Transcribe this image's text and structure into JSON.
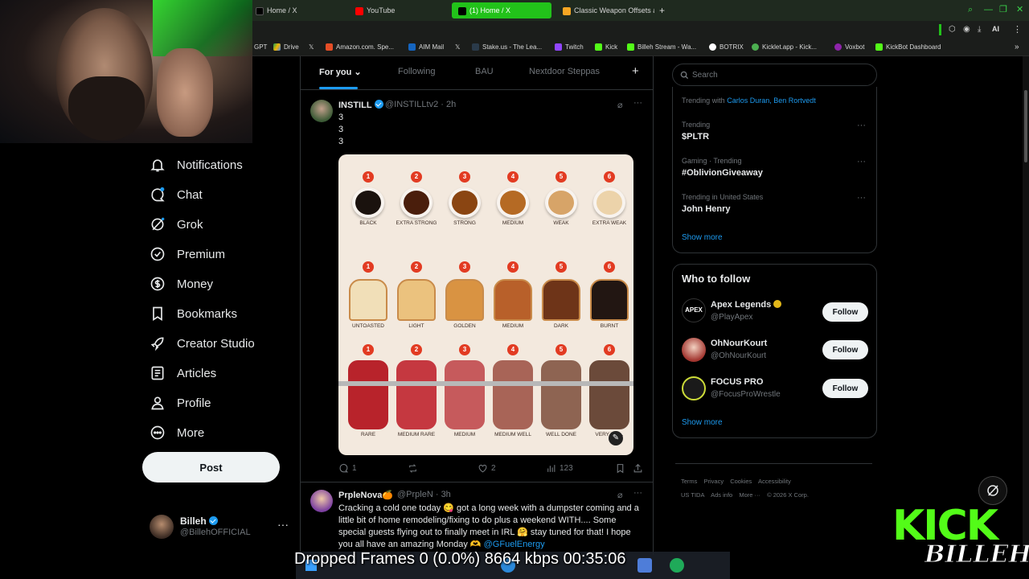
{
  "browser": {
    "tabs": [
      {
        "label": "Home / X",
        "active": false,
        "color": "#000000"
      },
      {
        "label": "YouTube",
        "active": false,
        "color": "#ff0000"
      },
      {
        "label": "(1) Home / X",
        "active": true,
        "color": "#000000"
      },
      {
        "label": "Classic Weapon Offsets at",
        "active": false,
        "color": "#f5a623"
      }
    ],
    "new_tab": "+",
    "toolbar_ai": "AI",
    "bookmarks": [
      {
        "label": "GPT"
      },
      {
        "label": "Drive"
      },
      {
        "label": ""
      },
      {
        "label": "Amazon.com. Spe..."
      },
      {
        "label": "AIM Mail"
      },
      {
        "label": ""
      },
      {
        "label": "Stake.us - The Lea..."
      },
      {
        "label": "Twitch"
      },
      {
        "label": "Kick"
      },
      {
        "label": "Billeh Stream - Wa..."
      },
      {
        "label": "BOTRIX"
      },
      {
        "label": "Kicklet.app - Kick..."
      },
      {
        "label": "Voxbot"
      },
      {
        "label": "KickBot Dashboard"
      }
    ]
  },
  "nav": {
    "items": [
      {
        "label": "Notifications",
        "icon": "bell-icon"
      },
      {
        "label": "Chat",
        "icon": "chat-icon",
        "badge": "1"
      },
      {
        "label": "Grok",
        "icon": "grok-icon"
      },
      {
        "label": "Premium",
        "icon": "premium-icon"
      },
      {
        "label": "Money",
        "icon": "money-icon"
      },
      {
        "label": "Bookmarks",
        "icon": "bookmark-icon"
      },
      {
        "label": "Creator Studio",
        "icon": "rocket-icon"
      },
      {
        "label": "Articles",
        "icon": "articles-icon"
      },
      {
        "label": "Profile",
        "icon": "person-icon"
      },
      {
        "label": "More",
        "icon": "more-circle-icon"
      }
    ],
    "post_label": "Post",
    "account": {
      "name": "Billeh",
      "handle": "@BillehOFFICIAL",
      "more": "···"
    }
  },
  "feed": {
    "tabs": [
      {
        "label": "For you",
        "active": true
      },
      {
        "label": "Following",
        "active": false
      },
      {
        "label": "BAU",
        "active": false
      },
      {
        "label": "Nextdoor Steppas",
        "active": false
      }
    ],
    "add_tab": "+",
    "tweets": [
      {
        "name": "INSTILL",
        "handle": "@INSTILLtv2 · 2h",
        "lines": [
          "3",
          "3",
          "3"
        ],
        "replies": "1",
        "reposts": "",
        "likes": "2",
        "views": "123"
      },
      {
        "name": "PrpleNova🍊",
        "handle": "@PrpleN · 3h",
        "text": "Cracking a cold one today 😋 got a long week with a dumpster coming and a little bit of home remodeling/fixing to do plus a weekend WITH.... Some special guests flying out to finally meet in IRL 🤗 stay tuned for that! I hope you all have an amazing Monday 🫶",
        "mention": "@GFuelEnergy"
      }
    ]
  },
  "infographic": {
    "coffee": [
      {
        "n": "1",
        "label": "BLACK",
        "color": "#1a120e"
      },
      {
        "n": "2",
        "label": "EXTRA STRONG",
        "color": "#4a1e0c"
      },
      {
        "n": "3",
        "label": "STRONG",
        "color": "#8a4512"
      },
      {
        "n": "4",
        "label": "MEDIUM",
        "color": "#b56a24"
      },
      {
        "n": "5",
        "label": "WEAK",
        "color": "#d7a468"
      },
      {
        "n": "6",
        "label": "EXTRA WEAK",
        "color": "#ecd3aa"
      }
    ],
    "toast": [
      {
        "n": "1",
        "label": "UNTOASTED",
        "color": "#f1dfb8"
      },
      {
        "n": "2",
        "label": "LIGHT",
        "color": "#ebc27e"
      },
      {
        "n": "3",
        "label": "GOLDEN",
        "color": "#d99342"
      },
      {
        "n": "4",
        "label": "MEDIUM",
        "color": "#b8602a"
      },
      {
        "n": "5",
        "label": "DARK",
        "color": "#6e3418"
      },
      {
        "n": "6",
        "label": "BURNT",
        "color": "#221612"
      }
    ],
    "steak": [
      {
        "n": "1",
        "label": "RARE",
        "color": "#b8232b"
      },
      {
        "n": "2",
        "label": "MEDIUM RARE",
        "color": "#c53840"
      },
      {
        "n": "3",
        "label": "MEDIUM",
        "color": "#c65a5c"
      },
      {
        "n": "4",
        "label": "MEDIUM WELL",
        "color": "#a86457"
      },
      {
        "n": "5",
        "label": "WELL DONE",
        "color": "#8e6452"
      },
      {
        "n": "6",
        "label": "VERY WE...",
        "color": "#6b4a3a"
      }
    ]
  },
  "sidebar": {
    "search_placeholder": "Search",
    "trends": [
      {
        "meta": "Trending with",
        "with": "Carlos Duran, Ben Rortvedt",
        "title": ""
      },
      {
        "meta": "Trending",
        "title": "$PLTR"
      },
      {
        "meta": "Gaming · Trending",
        "title": "#OblivionGiveaway"
      },
      {
        "meta": "Trending in United States",
        "title": "John Henry"
      }
    ],
    "show_more": "Show more",
    "who_to_follow_title": "Who to follow",
    "follow_suggestions": [
      {
        "name": "Apex Legends",
        "handle": "@PlayApex",
        "button": "Follow"
      },
      {
        "name": "OhNourKourt",
        "handle": "@OhNourKourt",
        "button": "Follow"
      },
      {
        "name": "FOCUS PRO",
        "handle": "@FocusProWrestle",
        "button": "Follow"
      }
    ],
    "show_more_2": "Show more",
    "footer": [
      "Terms",
      "Privacy",
      "Cookies",
      "Accessibility",
      "US TIDA",
      "Ads info",
      "More ···",
      "© 2026 X Corp."
    ]
  },
  "overlay": {
    "stream_stats": "Dropped Frames 0 (0.0%)   8664 kbps   00:35:06",
    "kick_text": "KICK",
    "billeh_text": "BILLEH"
  }
}
